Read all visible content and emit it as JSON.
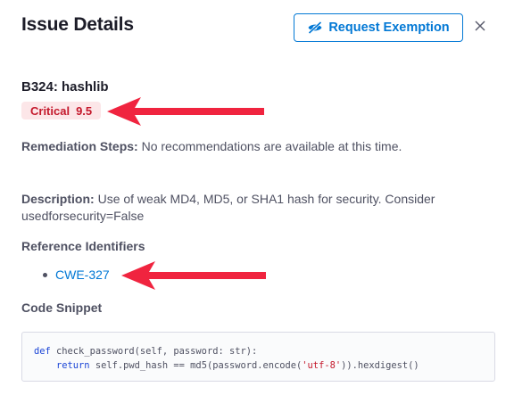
{
  "header": {
    "title": "Issue Details",
    "exemption_button": "Request Exemption",
    "exemption_icon": "eye-slash-icon",
    "close_icon": "close-icon"
  },
  "issue": {
    "name": "B324: hashlib",
    "severity_label": "Critical",
    "severity_score": "9.5"
  },
  "remediation": {
    "label": "Remediation Steps:",
    "text": "No recommendations are available at this time."
  },
  "description": {
    "label": "Description:",
    "text_line1": "Use of weak MD4, MD5, or SHA1 hash for security. Consider",
    "text_line2": "usedforsecurity=False"
  },
  "references": {
    "heading": "Reference Identifiers",
    "items": [
      "CWE-327"
    ]
  },
  "code_snippet": {
    "heading": "Code Snippet",
    "line1": {
      "keyword": "def",
      "text": " check_password(self, password: str):"
    },
    "line2": {
      "indent": "    ",
      "keyword": "return",
      "text_before": " self.pwd_hash == md5(password.encode(",
      "string": "'utf-8'",
      "text_after": ")).hexdigest()"
    }
  },
  "colors": {
    "accent": "#0278d5",
    "critical": "#c4182b",
    "critical_bg": "#fce6e8",
    "annotation_arrow": "#f0243f"
  }
}
